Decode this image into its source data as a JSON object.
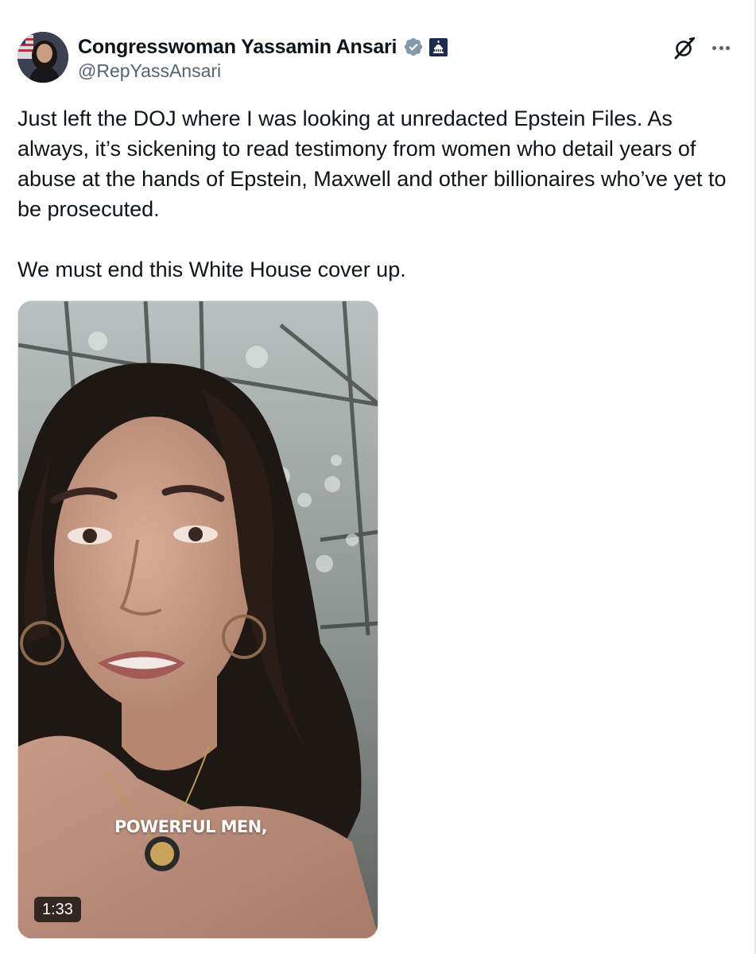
{
  "author": {
    "display_name": "Congresswoman Yassamin Ansari",
    "handle": "@RepYassAnsari",
    "verified_icon": "verified-badge-icon",
    "affiliation_icon": "capitol-dome-icon"
  },
  "actions": {
    "grok_icon": "grok-icon",
    "more_icon": "more-dots-icon"
  },
  "tweet": {
    "paragraphs": [
      "Just left the DOJ where I was looking at unredacted Epstein Files. As always, it’s sickening to read testimony from women who detail years of abuse at the hands of Epstein, Maxwell and other billionaires who’ve yet to be prosecuted.",
      "We must end this White House cover up."
    ]
  },
  "media": {
    "type": "video",
    "caption": "POWERFUL MEN,",
    "duration": "1:33"
  },
  "colors": {
    "text_primary": "#0f1419",
    "text_secondary": "#536471",
    "verified_badge": "#829aab",
    "affiliation_badge": "#1d2b4f"
  }
}
